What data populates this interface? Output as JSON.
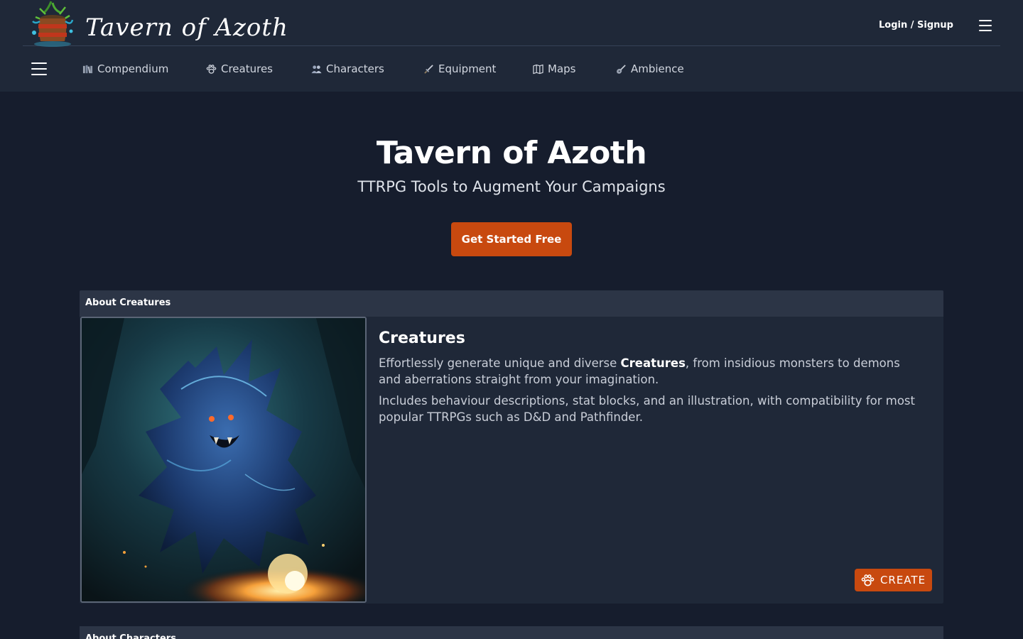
{
  "header": {
    "brand": "Tavern of Azoth",
    "login_label": "Login / Signup"
  },
  "nav": {
    "items": [
      {
        "label": "Compendium",
        "icon": "books-icon"
      },
      {
        "label": "Creatures",
        "icon": "paw-icon"
      },
      {
        "label": "Characters",
        "icon": "people-icon"
      },
      {
        "label": "Equipment",
        "icon": "sword-icon"
      },
      {
        "label": "Maps",
        "icon": "map-icon"
      },
      {
        "label": "Ambience",
        "icon": "lute-icon"
      }
    ]
  },
  "hero": {
    "title": "Tavern of Azoth",
    "subtitle": "TTRPG Tools to Augment Your Campaigns",
    "cta_label": "Get Started Free"
  },
  "sections": [
    {
      "header": "About Creatures",
      "title": "Creatures",
      "p1_before": "Effortlessly generate unique and diverse ",
      "p1_bold": "Creatures",
      "p1_after": ", from insidious monsters to demons and aberrations straight from your imagination.",
      "p2": "Includes behaviour descriptions, stat blocks, and an illustration, with compatibility for most popular TTRPGs such as D&D and Pathfinder.",
      "button_label": "CREATE"
    },
    {
      "header": "About Characters"
    }
  ],
  "colors": {
    "background": "#161d2d",
    "header": "#1f2838",
    "accent": "#c8490f",
    "card": "#1f2838",
    "card_header": "#2c3546"
  }
}
